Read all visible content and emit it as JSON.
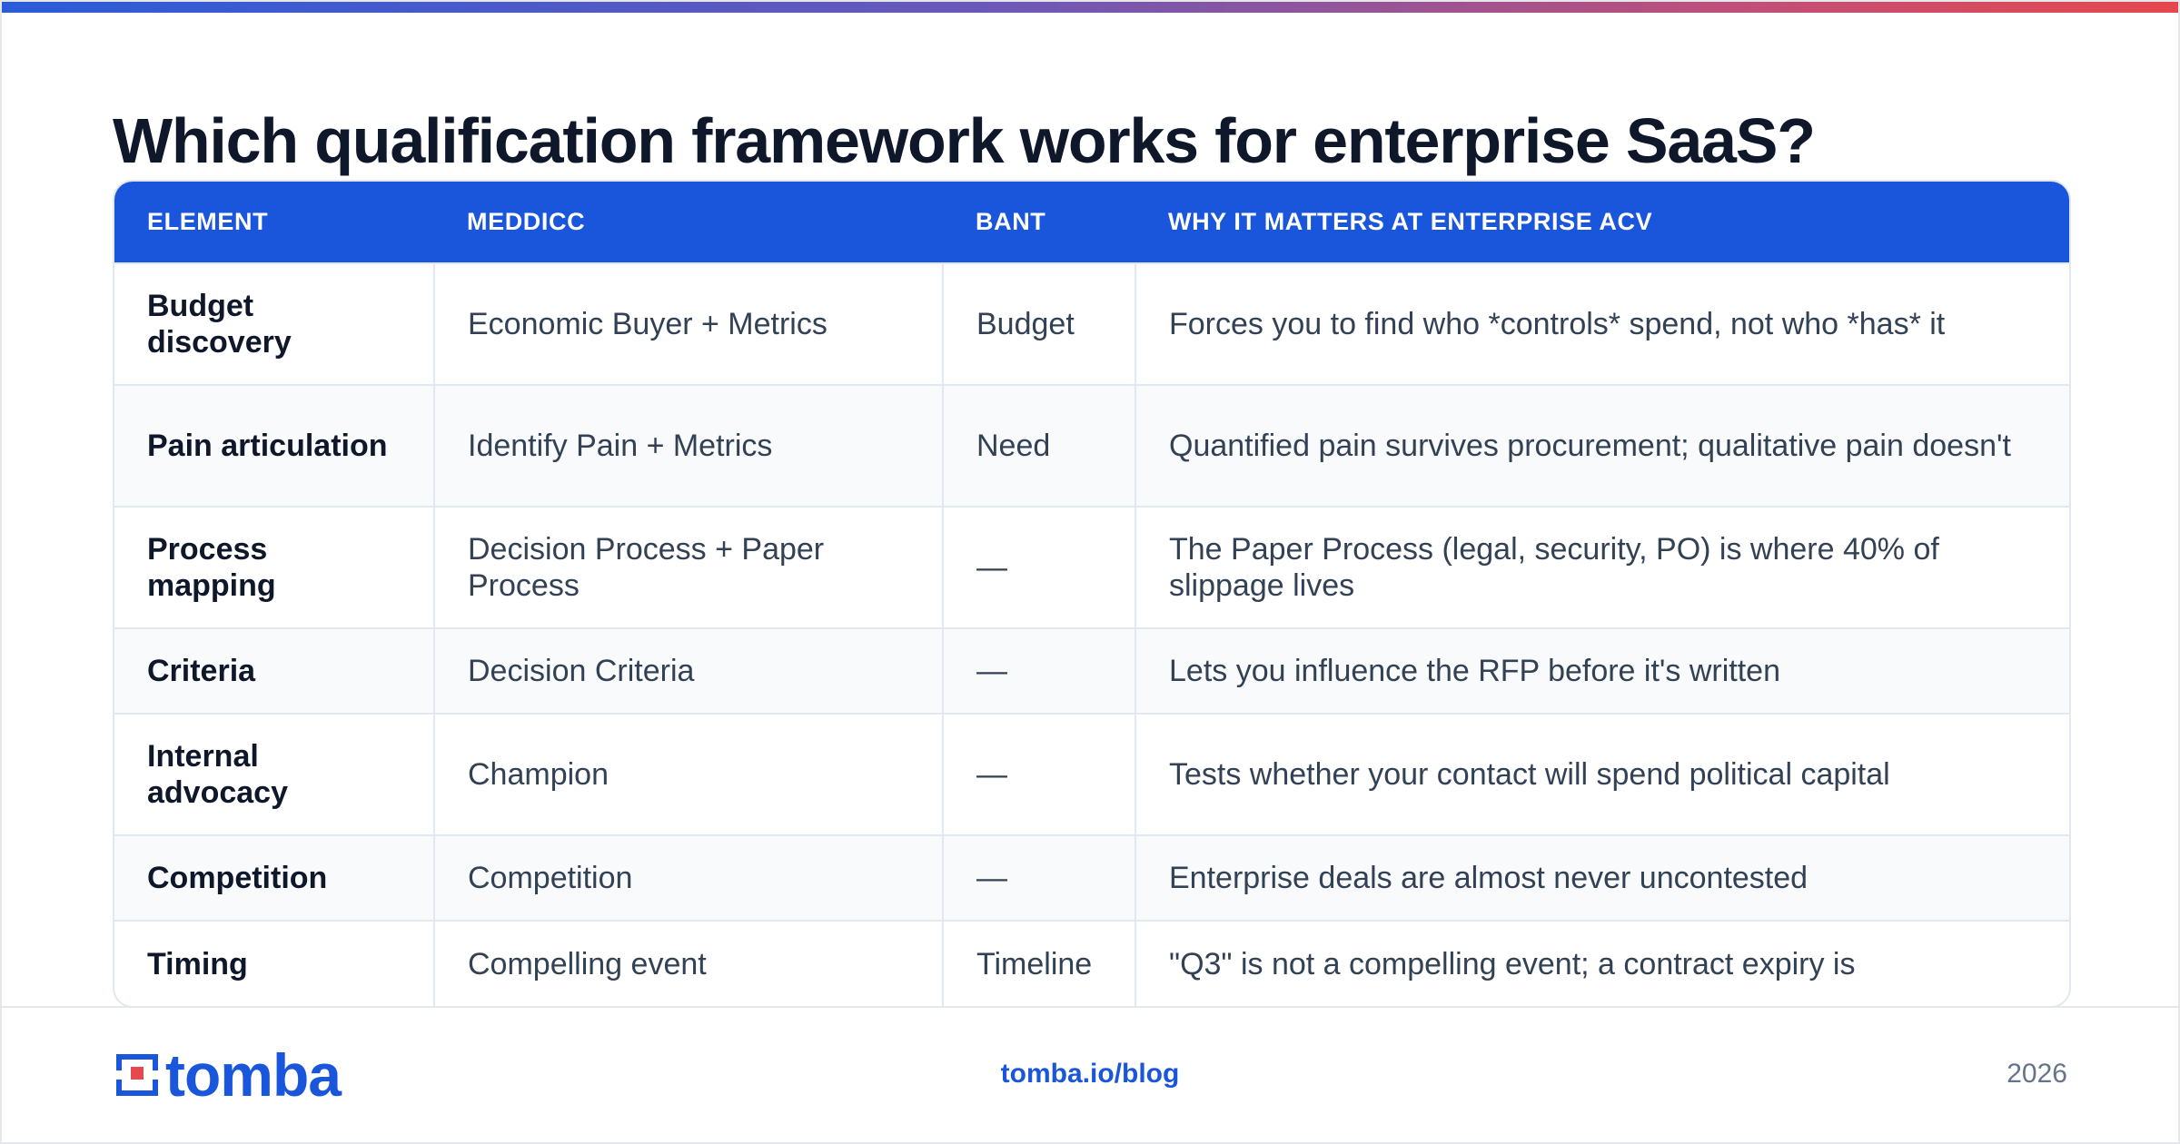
{
  "page": {
    "title": "Which qualification framework works for enterprise SaaS?"
  },
  "colors": {
    "accent": "#1a56db",
    "gradient_start": "#2b5cd8",
    "gradient_end": "#e5484d",
    "header_text": "#ffffff",
    "body_text": "#334155",
    "title_text": "#0f172a"
  },
  "table": {
    "columns": [
      "ELEMENT",
      "MEDDICC",
      "BANT",
      "WHY IT MATTERS AT ENTERPRISE ACV"
    ],
    "rows": [
      [
        "Budget discovery",
        "Economic Buyer + Metrics",
        "Budget",
        "Forces you to find who *controls* spend, not who *has* it"
      ],
      [
        "Pain articulation",
        "Identify Pain + Metrics",
        "Need",
        "Quantified pain survives procurement; qualitative pain doesn't"
      ],
      [
        "Process mapping",
        "Decision Process + Paper Process",
        "—",
        "The Paper Process (legal, security, PO) is where 40% of slippage lives"
      ],
      [
        "Criteria",
        "Decision Criteria",
        "—",
        "Lets you influence the RFP before it's written"
      ],
      [
        "Internal advocacy",
        "Champion",
        "—",
        "Tests whether your contact will spend political capital"
      ],
      [
        "Competition",
        "Competition",
        "—",
        "Enterprise deals are almost never uncontested"
      ],
      [
        "Timing",
        "Compelling event",
        "Timeline",
        "\"Q3\" is not a compelling event; a contract expiry is"
      ]
    ]
  },
  "footer": {
    "logo_text": "tomba",
    "logo_icon": "tomba-logo-icon",
    "link": "tomba.io/blog",
    "year": "2026"
  }
}
